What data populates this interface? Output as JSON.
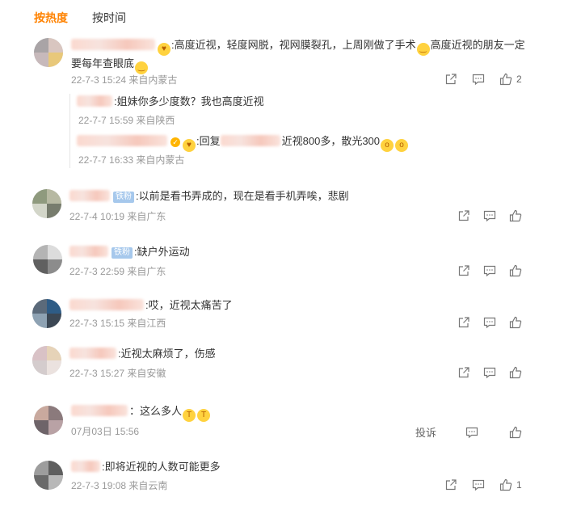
{
  "tabs": {
    "hot": "按热度",
    "time": "按时间"
  },
  "comments": [
    {
      "text1": ":高度近视，轻度网脱，视网膜裂孔，上周刚做了手术",
      "text2": "高度近视的朋友一定要每年查眼底",
      "meta": "22-7-3 15:24 来自内蒙古",
      "likes": "2",
      "replies": [
        {
          "text": ":姐妹你多少度数？我也高度近视",
          "meta": "22-7-7 15:59 来自陕西"
        },
        {
          "prefix": ":回复",
          "text": "近视800多，散光300",
          "meta": "22-7-7 16:33 来自内蒙古"
        }
      ]
    },
    {
      "badge": "铁粉",
      "text": ":以前是看书弄成的，现在是看手机弄唉，悲剧",
      "meta": "22-7-4 10:19 来自广东"
    },
    {
      "badge": "铁粉",
      "text": ":缺户外运动",
      "meta": "22-7-3 22:59 来自广东"
    },
    {
      "text": ":哎，近视太痛苦了",
      "meta": "22-7-3 15:15 来自江西"
    },
    {
      "text": ":近视太麻烦了，伤感",
      "meta": "22-7-3 15:27 来自安徽"
    },
    {
      "text": "：这么多人",
      "meta": "07月03日 15:56",
      "report": "投诉"
    },
    {
      "text": ":即将近视的人数可能更多",
      "meta": "22-7-3 19:08 来自云南",
      "likes": "1"
    }
  ],
  "colors": {
    "accent": "#ff8200",
    "meta": "#999999",
    "badge": "#a6c8ec"
  }
}
